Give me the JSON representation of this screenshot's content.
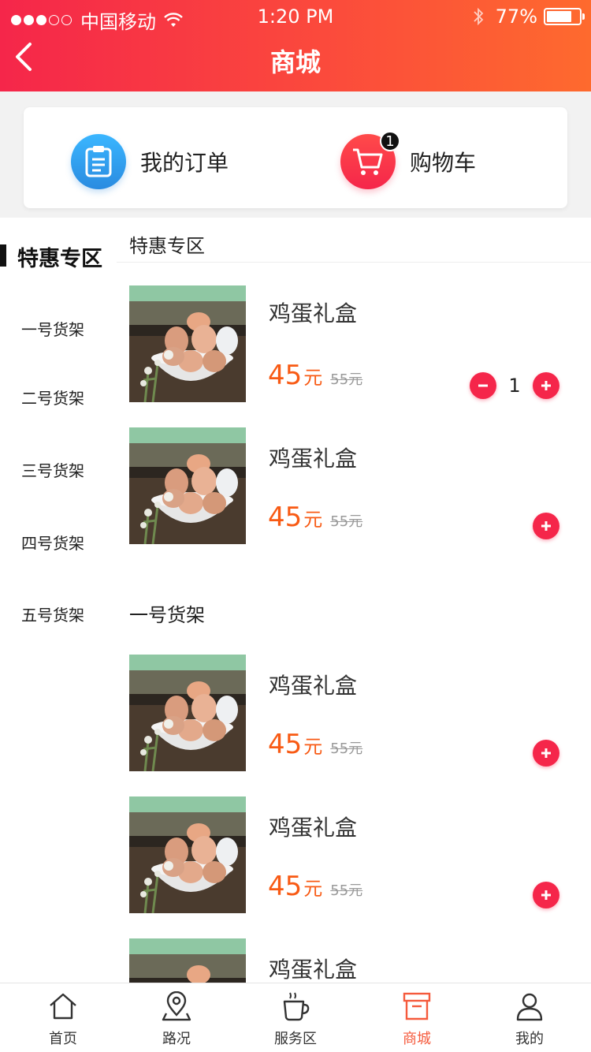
{
  "status_bar": {
    "carrier": "中国移动",
    "time": "1:20 PM",
    "battery": "77%",
    "battery_level": 0.77
  },
  "header": {
    "title": "商城",
    "back_icon": "chevron-left-icon"
  },
  "quick_actions": {
    "orders": {
      "label": "我的订单",
      "icon": "clipboard-icon"
    },
    "cart": {
      "label": "购物车",
      "icon": "cart-icon",
      "badge": "1"
    }
  },
  "sidebar": {
    "items": [
      {
        "label": "特惠专区",
        "active": true
      },
      {
        "label": "一号货架",
        "active": false
      },
      {
        "label": "二号货架",
        "active": false
      },
      {
        "label": "三号货架",
        "active": false
      },
      {
        "label": "四号货架",
        "active": false
      },
      {
        "label": "五号货架",
        "active": false
      }
    ]
  },
  "sections": [
    {
      "title": "特惠专区",
      "products": [
        {
          "name": "鸡蛋礼盒",
          "price": "45",
          "unit": "元",
          "old_price": "55元",
          "quantity": "1"
        },
        {
          "name": "鸡蛋礼盒",
          "price": "45",
          "unit": "元",
          "old_price": "55元"
        }
      ]
    },
    {
      "title": "一号货架",
      "products": [
        {
          "name": "鸡蛋礼盒",
          "price": "45",
          "unit": "元",
          "old_price": "55元"
        },
        {
          "name": "鸡蛋礼盒",
          "price": "45",
          "unit": "元",
          "old_price": "55元"
        },
        {
          "name": "鸡蛋礼盒"
        }
      ]
    }
  ],
  "tabbar": {
    "items": [
      {
        "label": "首页",
        "icon": "home-icon"
      },
      {
        "label": "路况",
        "icon": "location-pin-icon"
      },
      {
        "label": "服务区",
        "icon": "coffee-cup-icon"
      },
      {
        "label": "商城",
        "icon": "store-box-icon",
        "active": true
      },
      {
        "label": "我的",
        "icon": "user-icon"
      }
    ]
  },
  "colors": {
    "accent": "#f5264a",
    "price": "#f85a14",
    "active_tab": "#f55a3c"
  }
}
